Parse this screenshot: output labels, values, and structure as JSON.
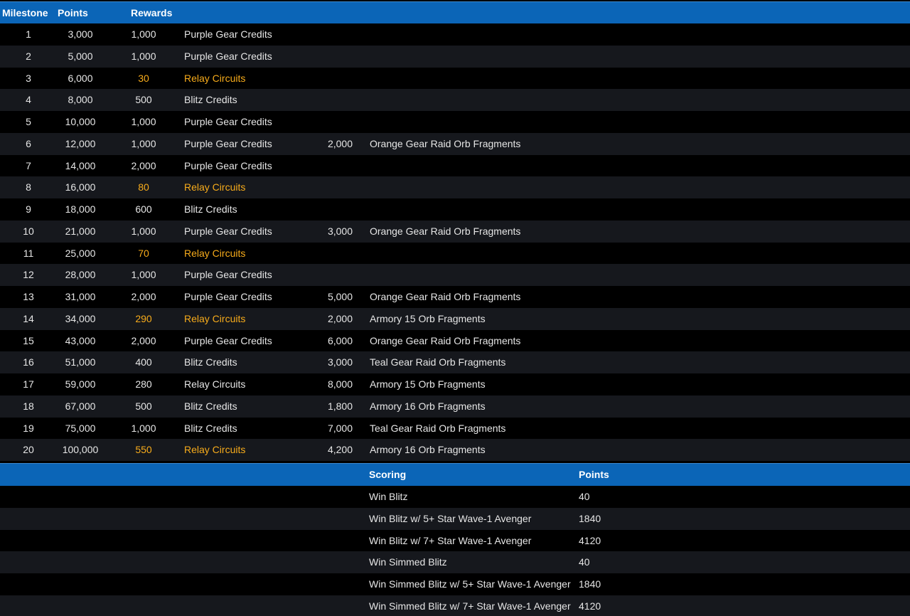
{
  "milestones": {
    "headers": {
      "milestone": "Milestone",
      "points": "Points",
      "rewards": "Rewards"
    },
    "rows": [
      {
        "milestone": "1",
        "points": "3,000",
        "reward1_amount": "1,000",
        "reward1_name": "Purple Gear Credits",
        "reward2_amount": "",
        "reward2_name": "",
        "highlight": false
      },
      {
        "milestone": "2",
        "points": "5,000",
        "reward1_amount": "1,000",
        "reward1_name": "Purple Gear Credits",
        "reward2_amount": "",
        "reward2_name": "",
        "highlight": false
      },
      {
        "milestone": "3",
        "points": "6,000",
        "reward1_amount": "30",
        "reward1_name": "Relay Circuits",
        "reward2_amount": "",
        "reward2_name": "",
        "highlight": true
      },
      {
        "milestone": "4",
        "points": "8,000",
        "reward1_amount": "500",
        "reward1_name": "Blitz Credits",
        "reward2_amount": "",
        "reward2_name": "",
        "highlight": false
      },
      {
        "milestone": "5",
        "points": "10,000",
        "reward1_amount": "1,000",
        "reward1_name": "Purple Gear Credits",
        "reward2_amount": "",
        "reward2_name": "",
        "highlight": false
      },
      {
        "milestone": "6",
        "points": "12,000",
        "reward1_amount": "1,000",
        "reward1_name": "Purple Gear Credits",
        "reward2_amount": "2,000",
        "reward2_name": "Orange Gear Raid Orb Fragments",
        "highlight": false
      },
      {
        "milestone": "7",
        "points": "14,000",
        "reward1_amount": "2,000",
        "reward1_name": "Purple Gear Credits",
        "reward2_amount": "",
        "reward2_name": "",
        "highlight": false
      },
      {
        "milestone": "8",
        "points": "16,000",
        "reward1_amount": "80",
        "reward1_name": "Relay Circuits",
        "reward2_amount": "",
        "reward2_name": "",
        "highlight": true
      },
      {
        "milestone": "9",
        "points": "18,000",
        "reward1_amount": "600",
        "reward1_name": "Blitz Credits",
        "reward2_amount": "",
        "reward2_name": "",
        "highlight": false
      },
      {
        "milestone": "10",
        "points": "21,000",
        "reward1_amount": "1,000",
        "reward1_name": "Purple Gear Credits",
        "reward2_amount": "3,000",
        "reward2_name": "Orange Gear Raid Orb Fragments",
        "highlight": false
      },
      {
        "milestone": "11",
        "points": "25,000",
        "reward1_amount": "70",
        "reward1_name": "Relay Circuits",
        "reward2_amount": "",
        "reward2_name": "",
        "highlight": true
      },
      {
        "milestone": "12",
        "points": "28,000",
        "reward1_amount": "1,000",
        "reward1_name": "Purple Gear Credits",
        "reward2_amount": "",
        "reward2_name": "",
        "highlight": false
      },
      {
        "milestone": "13",
        "points": "31,000",
        "reward1_amount": "2,000",
        "reward1_name": "Purple Gear Credits",
        "reward2_amount": "5,000",
        "reward2_name": "Orange Gear Raid Orb Fragments",
        "highlight": false
      },
      {
        "milestone": "14",
        "points": "34,000",
        "reward1_amount": "290",
        "reward1_name": "Relay Circuits",
        "reward2_amount": "2,000",
        "reward2_name": "Armory 15 Orb Fragments",
        "highlight": true
      },
      {
        "milestone": "15",
        "points": "43,000",
        "reward1_amount": "2,000",
        "reward1_name": "Purple Gear Credits",
        "reward2_amount": "6,000",
        "reward2_name": "Orange Gear Raid Orb Fragments",
        "highlight": false
      },
      {
        "milestone": "16",
        "points": "51,000",
        "reward1_amount": "400",
        "reward1_name": "Blitz Credits",
        "reward2_amount": "3,000",
        "reward2_name": "Teal Gear Raid Orb Fragments",
        "highlight": false
      },
      {
        "milestone": "17",
        "points": "59,000",
        "reward1_amount": "280",
        "reward1_name": "Relay Circuits",
        "reward2_amount": "8,000",
        "reward2_name": "Armory 15 Orb Fragments",
        "highlight": false
      },
      {
        "milestone": "18",
        "points": "67,000",
        "reward1_amount": "500",
        "reward1_name": "Blitz Credits",
        "reward2_amount": "1,800",
        "reward2_name": "Armory 16 Orb Fragments",
        "highlight": false
      },
      {
        "milestone": "19",
        "points": "75,000",
        "reward1_amount": "1,000",
        "reward1_name": "Blitz Credits",
        "reward2_amount": "7,000",
        "reward2_name": "Teal Gear Raid Orb Fragments",
        "highlight": false
      },
      {
        "milestone": "20",
        "points": "100,000",
        "reward1_amount": "550",
        "reward1_name": "Relay Circuits",
        "reward2_amount": "4,200",
        "reward2_name": "Armory 16 Orb Fragments",
        "highlight": true
      }
    ]
  },
  "scoring": {
    "headers": {
      "scoring": "Scoring",
      "points": "Points"
    },
    "rows": [
      {
        "label": "Win Blitz",
        "points": "40"
      },
      {
        "label": "Win Blitz w/ 5+ Star Wave-1 Avenger",
        "points": "1840"
      },
      {
        "label": "Win Blitz w/ 7+ Star Wave-1 Avenger",
        "points": "4120"
      },
      {
        "label": "Win Simmed Blitz",
        "points": "40"
      },
      {
        "label": "Win Simmed Blitz w/ 5+ Star Wave-1 Avenger",
        "points": "1840"
      },
      {
        "label": "Win Simmed Blitz w/ 7+ Star Wave-1 Avenger",
        "points": "4120"
      }
    ]
  },
  "colors": {
    "header_bg": "#0b65b7",
    "row_dark": "#000000",
    "row_alt": "#16181d",
    "highlight": "#f8ac1b",
    "text": "#e6e6e6"
  }
}
